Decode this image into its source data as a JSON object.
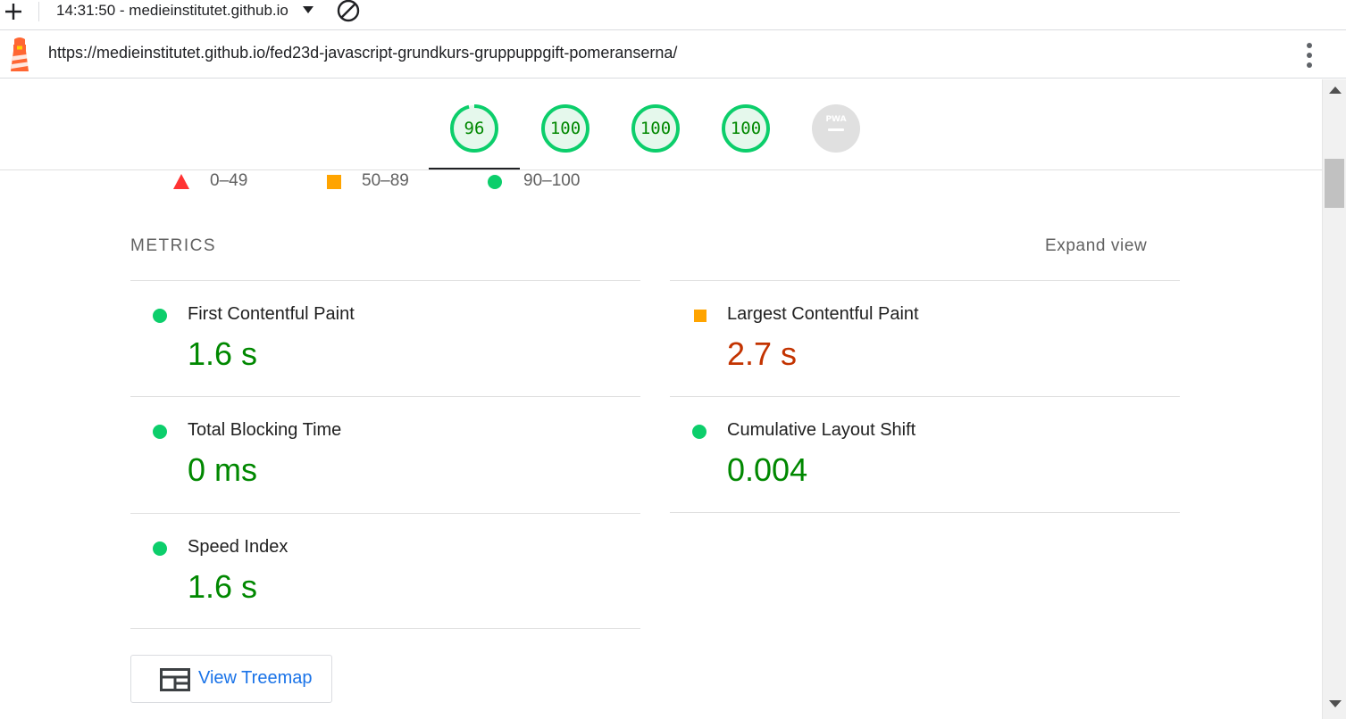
{
  "toolbar": {
    "new_icon": "plus-icon",
    "report_label": "14:31:50 - medieinstitutet.github.io",
    "clear_icon": "block-icon"
  },
  "urlbar": {
    "logo_icon": "lighthouse-icon",
    "url": "https://medieinstitutet.github.io/fed23d-javascript-grundkurs-gruppuppgift-pomeranserna/",
    "menu_icon": "more-vertical-icon"
  },
  "scores": [
    {
      "value": "96",
      "score": 0.96,
      "color": "#0cce6b"
    },
    {
      "value": "100",
      "score": 1.0,
      "color": "#0cce6b"
    },
    {
      "value": "100",
      "score": 1.0,
      "color": "#0cce6b"
    },
    {
      "value": "100",
      "score": 1.0,
      "color": "#0cce6b"
    },
    {
      "label": "PWA",
      "icon": "pwa-badge-icon",
      "color": "#e0e0e0"
    }
  ],
  "legend": [
    {
      "range": "0–49",
      "icon": "triangle-icon",
      "color": "#ff3333"
    },
    {
      "range": "50–89",
      "icon": "square-icon",
      "color": "#ffa400"
    },
    {
      "range": "90–100",
      "icon": "circle-icon",
      "color": "#0cce6b"
    }
  ],
  "metrics": {
    "title": "METRICS",
    "expand_label": "Expand view",
    "items": [
      {
        "title": "First Contentful Paint",
        "value": "1.6 s",
        "rating": "pass"
      },
      {
        "title": "Largest Contentful Paint",
        "value": "2.7 s",
        "rating": "average"
      },
      {
        "title": "Total Blocking Time",
        "value": "0 ms",
        "rating": "pass"
      },
      {
        "title": "Cumulative Layout Shift",
        "value": "0.004",
        "rating": "pass"
      },
      {
        "title": "Speed Index",
        "value": "1.6 s",
        "rating": "pass"
      }
    ]
  },
  "treemap": {
    "icon": "treemap-icon",
    "label": "View Treemap"
  },
  "colors": {
    "pass": "#008800",
    "average": "#c33300",
    "link": "#1a73e8"
  }
}
